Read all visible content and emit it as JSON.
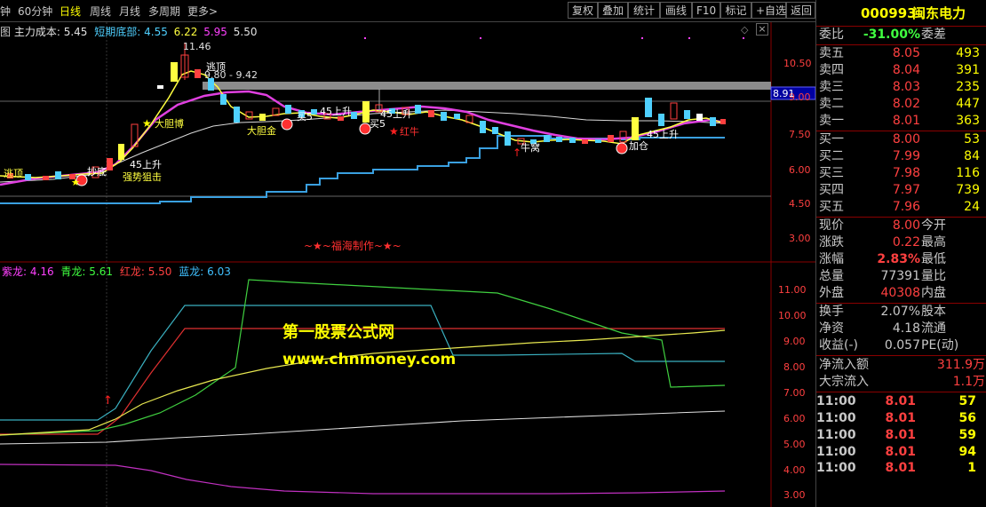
{
  "toolbar": {
    "timeframes": [
      "钟",
      "60分钟",
      "日线",
      "周线",
      "月线",
      "多周期",
      "更多>"
    ],
    "active_timeframe": "日线",
    "right_buttons": [
      "复权",
      "叠加",
      "统计",
      "画线",
      "F10",
      "标记",
      "+自选",
      "返回"
    ]
  },
  "indicator_bar": {
    "prefix": "图",
    "main_cost_label": "主力成本: 5.45",
    "bottom_label": "短期底部:",
    "values": [
      "4.55",
      "6.22",
      "5.95",
      "5.50"
    ]
  },
  "main_chart": {
    "y_ticks": [
      "10.50",
      "9.00",
      "7.50",
      "6.00",
      "4.50",
      "3.00"
    ],
    "price_tag": "8.91",
    "annotations": [
      "11.46",
      "逃顶",
      "9.80 - 9.42",
      "大胆博",
      "逃顶",
      "抄底",
      "45上升",
      "强势狙击",
      "买5",
      "买5",
      "45上升",
      "红牛",
      "大胆金",
      "45上升",
      "牛窝",
      "45上升",
      "加仓"
    ],
    "watermark": "~★~福海制作~★~"
  },
  "sub_chart": {
    "legend": [
      {
        "name": "紫龙:",
        "value": "4.16",
        "color": "#ff40ff"
      },
      {
        "name": "青龙:",
        "value": "5.61",
        "color": "#40ff40"
      },
      {
        "name": "红龙:",
        "value": "5.50",
        "color": "#ff4040"
      },
      {
        "name": "蓝龙:",
        "value": "6.03",
        "color": "#40c0ff"
      }
    ],
    "y_ticks": [
      "11.00",
      "10.00",
      "9.00",
      "8.00",
      "7.00",
      "6.00",
      "5.00",
      "4.00",
      "3.00"
    ],
    "site_title": "第一股票公式网",
    "site_url": "www.chnmoney.com"
  },
  "panel": {
    "code": "000993",
    "name": "闽东电力",
    "weibi_label": "委比",
    "weibi_value": "-31.00%",
    "weicha_label": "委差",
    "sells": [
      {
        "label": "卖五",
        "price": "8.05",
        "vol": "493"
      },
      {
        "label": "卖四",
        "price": "8.04",
        "vol": "391"
      },
      {
        "label": "卖三",
        "price": "8.03",
        "vol": "235"
      },
      {
        "label": "卖二",
        "price": "8.02",
        "vol": "447"
      },
      {
        "label": "卖一",
        "price": "8.01",
        "vol": "363"
      }
    ],
    "buys": [
      {
        "label": "买一",
        "price": "8.00",
        "vol": "53"
      },
      {
        "label": "买二",
        "price": "7.99",
        "vol": "84"
      },
      {
        "label": "买三",
        "price": "7.98",
        "vol": "116"
      },
      {
        "label": "买四",
        "price": "7.97",
        "vol": "739"
      },
      {
        "label": "买五",
        "price": "7.96",
        "vol": "24"
      }
    ],
    "stats": [
      {
        "l1": "现价",
        "v1": "8.00",
        "l2": "今开",
        "c": "#ff4040"
      },
      {
        "l1": "涨跌",
        "v1": "0.22",
        "l2": "最高",
        "c": "#ff4040"
      },
      {
        "l1": "涨幅",
        "v1": "2.83%",
        "l2": "最低",
        "c": "#ff4040"
      },
      {
        "l1": "总量",
        "v1": "77391",
        "l2": "量比",
        "c": "#c8c8c8"
      },
      {
        "l1": "外盘",
        "v1": "40308",
        "l2": "内盘",
        "c": "#ff4040"
      }
    ],
    "stats2": [
      {
        "l1": "换手",
        "v1": "2.07%",
        "l2": "股本"
      },
      {
        "l1": "净资",
        "v1": "4.18",
        "l2": "流通"
      },
      {
        "l1": "收益(-)",
        "v1": "0.057",
        "l2": "PE(动)"
      }
    ],
    "flows": [
      {
        "label": "净流入额",
        "value": "311.9万"
      },
      {
        "label": "大宗流入",
        "value": "1.1万"
      }
    ],
    "ticks": [
      {
        "time": "11:00",
        "price": "8.01",
        "vol": "57"
      },
      {
        "time": "11:00",
        "price": "8.01",
        "vol": "56"
      },
      {
        "time": "11:00",
        "price": "8.01",
        "vol": "59"
      },
      {
        "time": "11:00",
        "price": "8.01",
        "vol": "94"
      },
      {
        "time": "11:00",
        "price": "8.01",
        "vol": "1"
      }
    ]
  }
}
